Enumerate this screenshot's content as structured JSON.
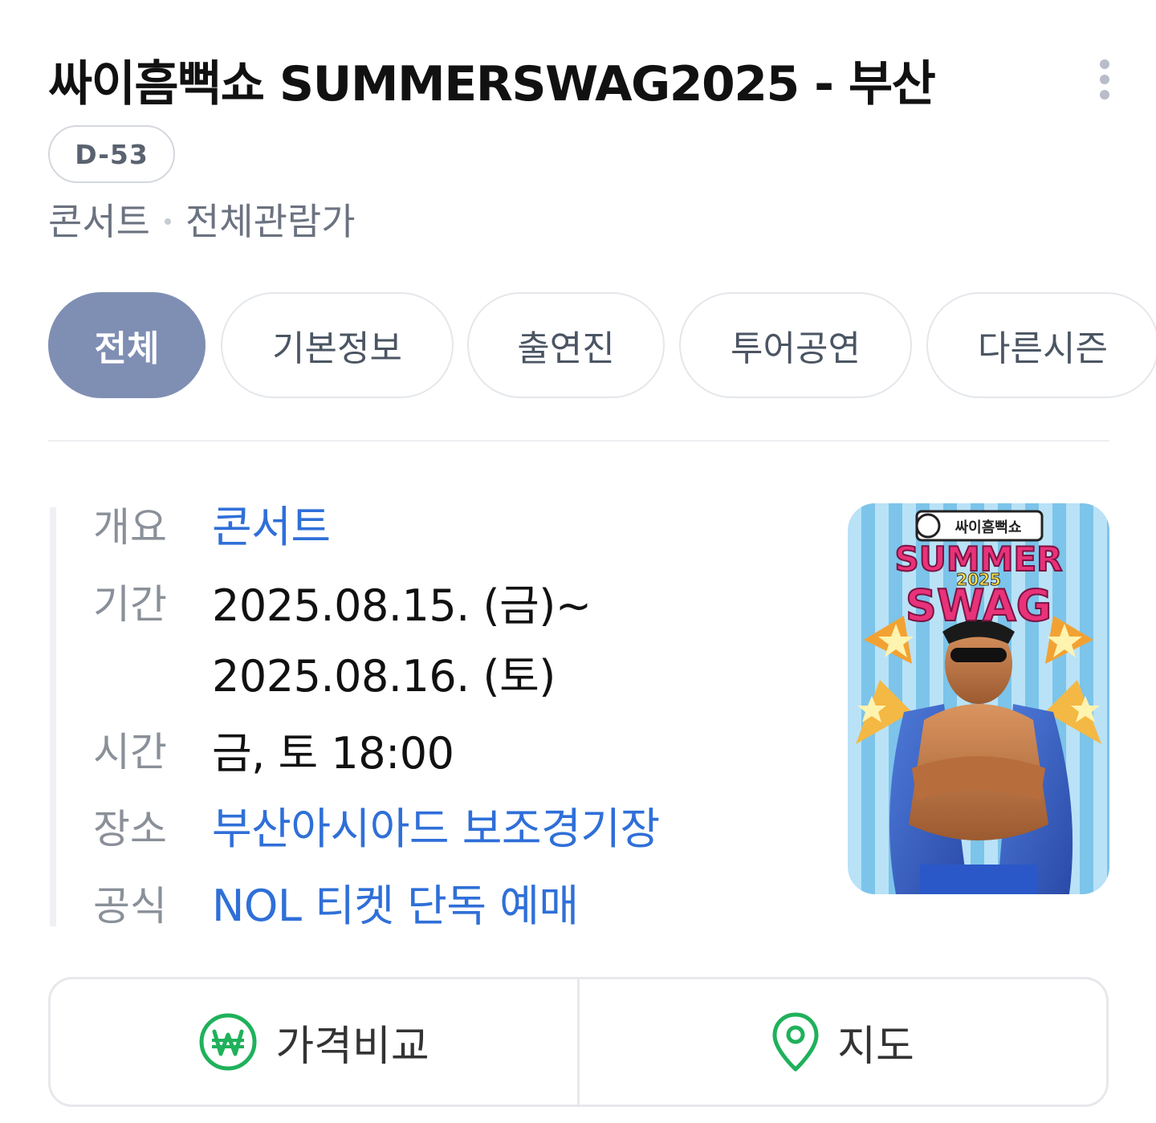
{
  "header": {
    "title": "싸이흠뻑쇼 SUMMERSWAG2025 - 부산",
    "dday": "D-53",
    "genre": "콘서트",
    "rating": "전체관람가"
  },
  "tabs": [
    {
      "label": "전체",
      "active": true
    },
    {
      "label": "기본정보",
      "active": false
    },
    {
      "label": "출연진",
      "active": false
    },
    {
      "label": "투어공연",
      "active": false
    },
    {
      "label": "다른시즌",
      "active": false
    }
  ],
  "info": {
    "overview_label": "개요",
    "overview_value": "콘서트",
    "period_label": "기간",
    "period_start": "2025.08.15. (금)~",
    "period_end": "2025.08.16. (토)",
    "time_label": "시간",
    "time_value": "금, 토 18:00",
    "venue_label": "장소",
    "venue_value": "부산아시아드 보조경기장",
    "official_label": "공식",
    "official_value": "NOL 티켓 단독 예매"
  },
  "poster": {
    "logo_text": "싸이흠뻑쇼",
    "line1": "SUMMER",
    "year": "2025",
    "line2": "SWAG"
  },
  "actions": {
    "price_compare": "가격비교",
    "map": "지도"
  },
  "colors": {
    "active_tab": "#7f8eb3",
    "link": "#2f6fd8",
    "icon_green": "#1fb15b"
  },
  "icons": {
    "more": "more-vertical-icon",
    "won": "won-circle-icon",
    "map_pin": "map-pin-icon"
  }
}
